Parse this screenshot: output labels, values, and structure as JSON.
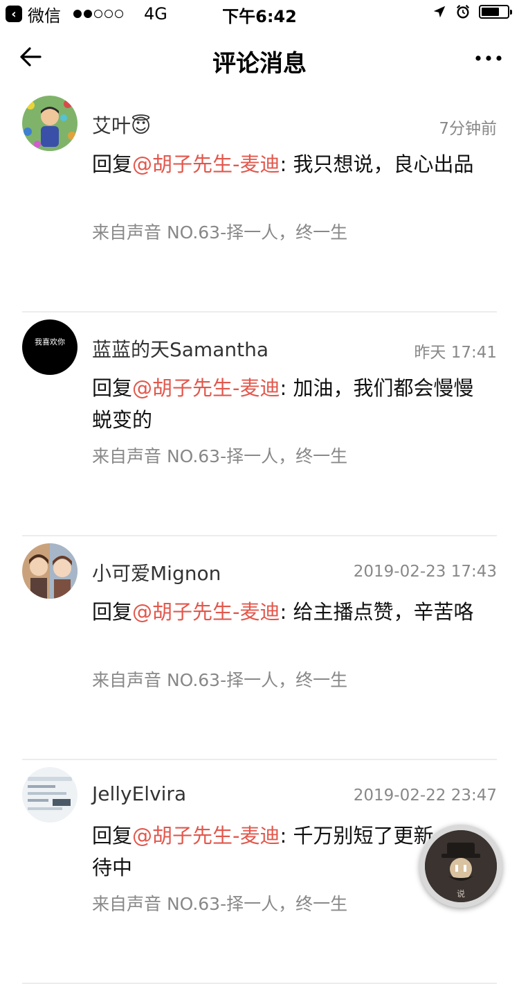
{
  "status_bar": {
    "back_app_label": "微信",
    "network": "4G",
    "time": "下午6:42"
  },
  "nav": {
    "title": "评论消息"
  },
  "comments": [
    {
      "name": "艾叶😇",
      "time": "7分钟前",
      "reply_prefix": "回复",
      "mention": "@胡子先生-麦迪",
      "text": ": 我只想说，良心出品",
      "source": "来自声音 NO.63-择一人，终一生"
    },
    {
      "name": "蓝蓝的天Samantha",
      "time": "昨天 17:41",
      "reply_prefix": "回复",
      "mention": "@胡子先生-麦迪",
      "text": ": 加油，我们都会慢慢蜕变的",
      "source": "来自声音 NO.63-择一人，终一生"
    },
    {
      "name": "小可爱Mignon",
      "time": "2019-02-23 17:43",
      "reply_prefix": "回复",
      "mention": "@胡子先生-麦迪",
      "text": ": 给主播点赞，辛苦咯",
      "source": "来自声音 NO.63-择一人，终一生"
    },
    {
      "name": "JellyElvira",
      "time": "2019-02-22 23:47",
      "reply_prefix": "回复",
      "mention": "@胡子先生-麦迪",
      "text": ": 千万别短了更新，期待中",
      "source": "来自声音 NO.63-择一人，终一生"
    }
  ],
  "avatar_text": {
    "second": "我喜欢你"
  },
  "fab": {
    "badge": "说"
  },
  "colors": {
    "mention": "#e2574c",
    "meta": "#888888",
    "divider": "#ececec"
  }
}
